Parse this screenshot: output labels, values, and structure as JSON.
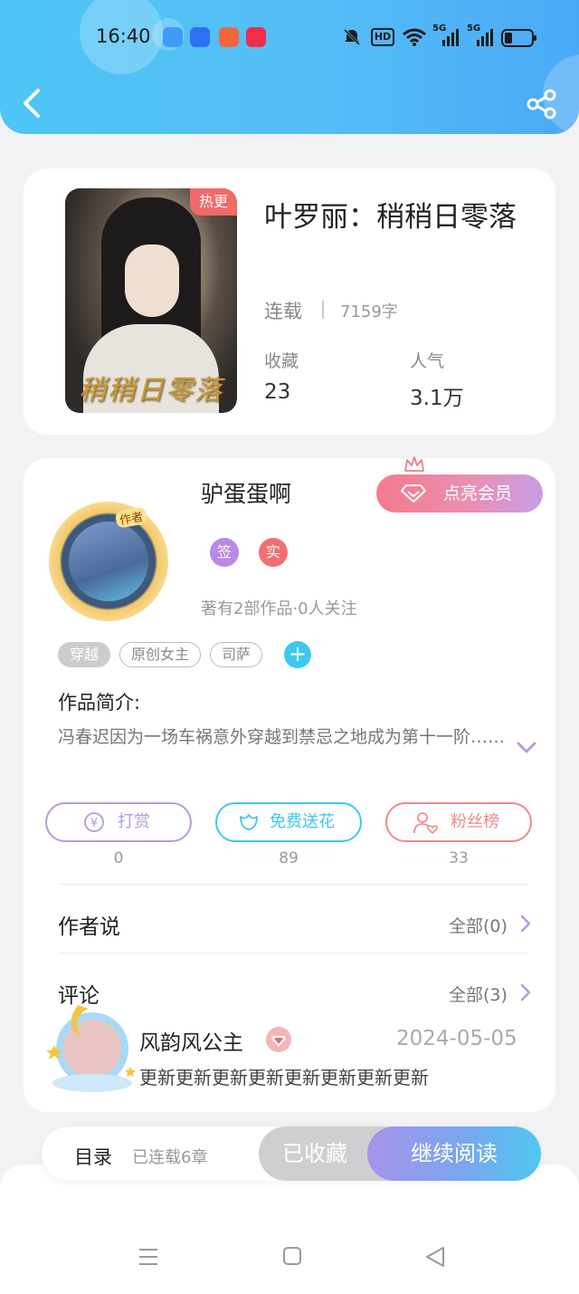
{
  "status_bar": {
    "time": "16:40",
    "icons": [
      "app-notification-icons",
      "mute-icon",
      "hd-icon",
      "wifi-icon",
      "signal-5g-icon",
      "battery-icon"
    ],
    "hd_label": "HD",
    "network_labels": [
      "5G",
      "5G"
    ]
  },
  "header": {
    "colors": {
      "gradient_start": "#4ec6f5",
      "gradient_end": "#4aa9f6"
    }
  },
  "book": {
    "title": "叶罗丽：稍稍日零落",
    "badge": "热更",
    "status": "连载",
    "word_count": "7159字",
    "stats": [
      {
        "label": "收藏",
        "value": "23"
      },
      {
        "label": "人气",
        "value": "3.1万"
      }
    ],
    "cover_title": "稍稍日零落"
  },
  "author": {
    "name": "驴蛋蛋啊",
    "avatar_tag": "作者",
    "vip_button": "点亮会员",
    "badges": [
      "签",
      "实"
    ],
    "meta": "著有2部作品·0人关注",
    "tags": [
      "穿越",
      "原创女主",
      "司萨"
    ]
  },
  "intro": {
    "heading": "作品简介:",
    "text": "冯春迟因为一场车祸意外穿越到禁忌之地成为第十一阶……"
  },
  "actions": [
    {
      "label": "打赏",
      "count": "0",
      "color": "#b79be0"
    },
    {
      "label": "免费送花",
      "count": "89",
      "color": "#3fc8ee"
    },
    {
      "label": "粉丝榜",
      "count": "33",
      "color": "#f08a8a"
    }
  ],
  "author_says": {
    "title": "作者说",
    "link": "全部(0)"
  },
  "comments": {
    "title": "评论",
    "link": "全部(3)",
    "items": [
      {
        "user": "风韵风公主",
        "date": "2024-05-05",
        "text": "更新更新更新更新更新更新更新更新"
      }
    ]
  },
  "bottom_bar": {
    "toc_label": "目录",
    "toc_count": "已连载6章",
    "collected_label": "已收藏",
    "read_label": "继续阅读"
  },
  "nav": {
    "icons": [
      "menu-icon",
      "home-icon",
      "back-icon"
    ]
  }
}
